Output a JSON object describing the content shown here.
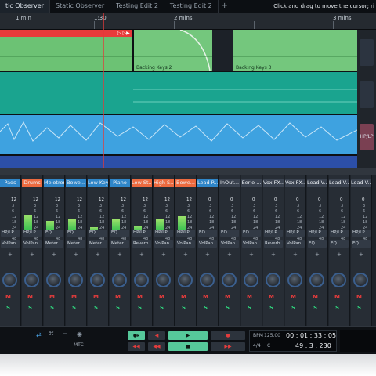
{
  "tabs": [
    "tic Observer",
    "Static Observer",
    "Testing Edit 2",
    "Testing Edit 2"
  ],
  "tab_add": "+",
  "hint": "Click and drag to move the cursor; ri",
  "ruler": [
    "1 min",
    "1:30",
    "2 mins",
    "3 mins"
  ],
  "clips": {
    "backing_a": "Backing Keys 2",
    "backing_b": "Backing Keys 3",
    "clip_marks": "▷ ▷▶"
  },
  "side": {
    "hp_label": "HP/LP"
  },
  "strips": [
    {
      "name": "Pads",
      "color": "#2f86c9",
      "fx": [
        "HP/LP",
        "VolPan"
      ],
      "val": "12"
    },
    {
      "name": "Drums",
      "color": "#ec6a3f",
      "fx": [
        "HP/LP",
        "VolPan"
      ],
      "val": "12"
    },
    {
      "name": "Melotron",
      "color": "#2f86c9",
      "fx": [
        "EQ",
        "Meter"
      ],
      "val": "12"
    },
    {
      "name": "Bowe...",
      "color": "#2f86c9",
      "fx": [
        "EQ",
        "Meter"
      ],
      "val": "12"
    },
    {
      "name": "Low Keys",
      "color": "#2f86c9",
      "fx": [
        "EQ",
        "Meter"
      ],
      "val": "12"
    },
    {
      "name": "Piano",
      "color": "#2f86c9",
      "fx": [
        "EQ",
        "Meter"
      ],
      "val": "12"
    },
    {
      "name": "Low St...",
      "color": "#ec6a3f",
      "fx": [
        "HP/LP",
        "Reverb"
      ],
      "val": "12"
    },
    {
      "name": "High S...",
      "color": "#ec6a3f",
      "fx": [
        "HP/LP",
        "VolPan"
      ],
      "val": "12"
    },
    {
      "name": "Bowe...",
      "color": "#ec6a3f",
      "fx": [
        "HP/LP",
        "VolPan"
      ],
      "val": "12"
    },
    {
      "name": "Lead P...",
      "color": "#2f86c9",
      "fx": [
        "EQ",
        "VolPan"
      ],
      "val": "0"
    },
    {
      "name": "InOut...",
      "color": "#3b4350",
      "fx": [
        "EQ",
        "VolPan"
      ],
      "val": "0"
    },
    {
      "name": "Eerie ...",
      "color": "#3b4350",
      "fx": [
        "EQ",
        "VolPan"
      ],
      "val": "0"
    },
    {
      "name": "Vox FX...",
      "color": "#3b4350",
      "fx": [
        "HP/LP",
        "Reverb"
      ],
      "val": "0"
    },
    {
      "name": "Vox FX...",
      "color": "#3b4350",
      "fx": [
        "HP/LP",
        "VolPan"
      ],
      "val": "0"
    },
    {
      "name": "Lead V...",
      "color": "#3b4350",
      "fx": [
        "HP/LP",
        "EQ"
      ],
      "val": "0"
    },
    {
      "name": "Lead V...",
      "color": "#3b4350",
      "fx": [
        "HP/LP",
        "EQ"
      ],
      "val": "0"
    },
    {
      "name": "Lead V...",
      "color": "#3b4350",
      "fx": [
        "HP/LP",
        "EQ"
      ],
      "val": "0"
    }
  ],
  "mute_label": "M",
  "solo_label": "S",
  "plus": "+",
  "db_marks": [
    "3",
    "6",
    "12",
    "18",
    "24",
    "36",
    "48"
  ],
  "meters": [
    0,
    0.55,
    0.35,
    0.4,
    0.15,
    0.4,
    0.2,
    0.4,
    0.5,
    0,
    0,
    0,
    0,
    0,
    0,
    0,
    0
  ],
  "transport": {
    "mtc": "MTC",
    "bpm_label": "BPM",
    "bpm": "125.00",
    "sig": "4/4",
    "key": "C",
    "time": "00 : 01 : 33 : 05",
    "bars": "49 . 3 . 230"
  }
}
